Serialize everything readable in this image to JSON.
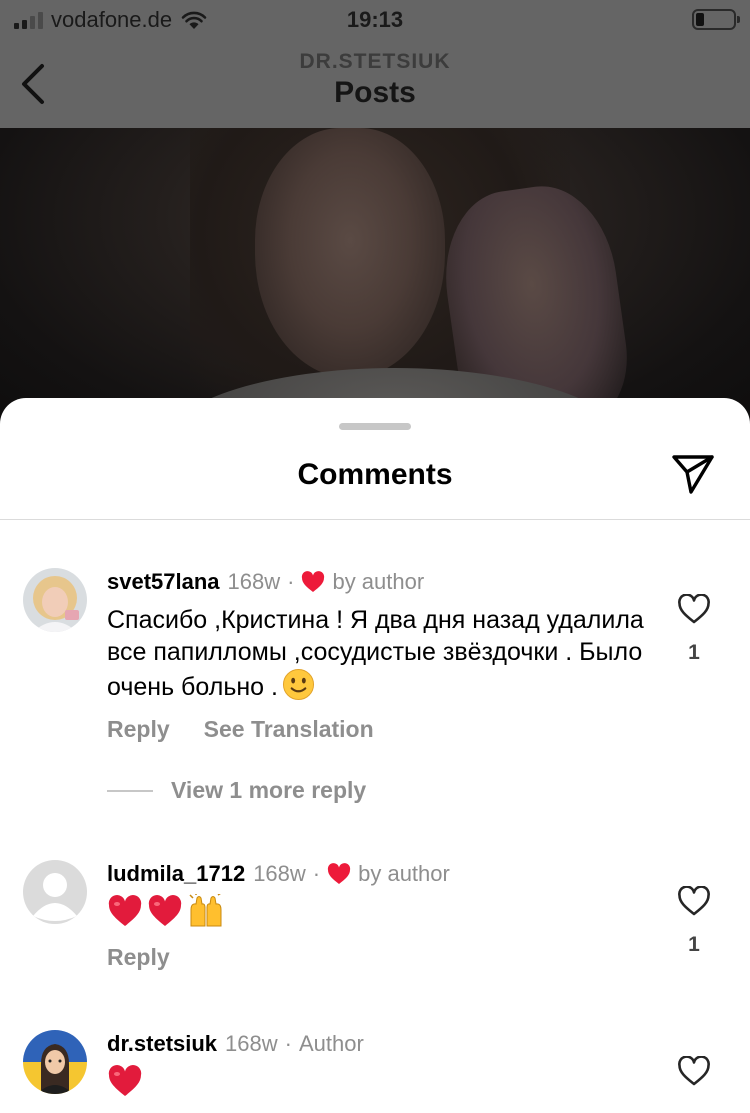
{
  "status_bar": {
    "carrier": "vodafone.de",
    "time": "19:13",
    "signal_bars": 4,
    "signal_bars_filled": 2,
    "battery_level": 0.15
  },
  "header": {
    "account": "DR.STETSIUK",
    "title": "Posts",
    "back_icon": "chevron-left-icon"
  },
  "sheet": {
    "title": "Comments",
    "share_icon": "send-icon"
  },
  "comments": [
    {
      "username": "svet57lana",
      "time": "168w",
      "liked_by_author": true,
      "by_author_label": "by author",
      "text": "Спасибо ,Кристина ! Я два дня назад удалила все папилломы ,сосудистые звёздочки . Было очень больно .",
      "trailing_emoji": "slightly-smiling-face",
      "actions": [
        "Reply",
        "See Translation"
      ],
      "likes": "1",
      "view_replies": "View 1 more reply"
    },
    {
      "username": "ludmila_1712",
      "time": "168w",
      "liked_by_author": true,
      "by_author_label": "by author",
      "emojis": [
        "red-heart",
        "red-heart",
        "raising-hands"
      ],
      "actions": [
        "Reply"
      ],
      "likes": "1"
    },
    {
      "username": "dr.stetsiuk",
      "time": "168w",
      "author_label": "Author",
      "emojis": [
        "red-heart"
      ]
    }
  ],
  "colors": {
    "heart_red": "#ed1a3a",
    "muted_text": "#8e8e8e",
    "dim_overlay": "#656565"
  }
}
